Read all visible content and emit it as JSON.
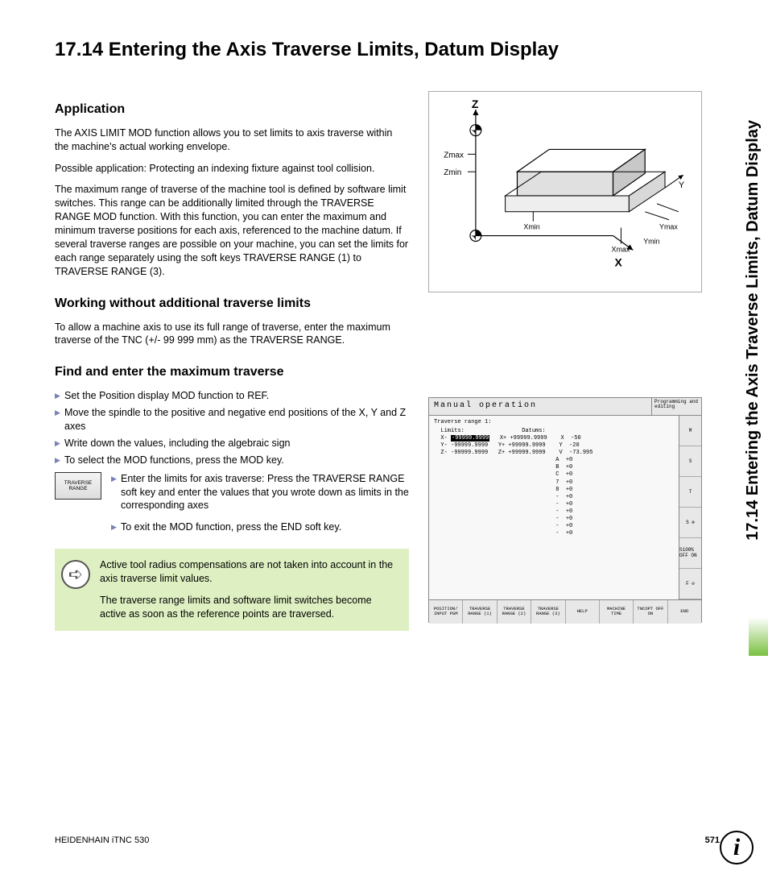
{
  "sideTab": "17.14 Entering the Axis Traverse Limits, Datum Display",
  "title": "17.14 Entering the Axis Traverse Limits, Datum Display",
  "h_application": "Application",
  "p_app_1": "The AXIS LIMIT MOD function allows you to set limits to axis traverse within the machine's actual working envelope.",
  "p_app_2": "Possible application: Protecting an indexing fixture against tool collision.",
  "p_app_3": "The maximum range of traverse of the machine tool is defined by software limit switches. This range can be additionally limited through the TRAVERSE RANGE MOD function. With this function, you can enter the maximum and minimum traverse positions for each axis, referenced to the machine datum. If several traverse ranges are possible on your machine, you can set the limits for each range separately using the soft keys TRAVERSE RANGE (1) to TRAVERSE RANGE (3).",
  "h_working": "Working without additional traverse limits",
  "p_working": "To allow a machine axis to use its full range of traverse, enter the maximum traverse of the TNC (+/- 99 999 mm) as the TRAVERSE RANGE.",
  "h_find": "Find and enter the maximum traverse",
  "bullets": [
    "Set the Position display MOD function to REF.",
    "Move the spindle to the positive and negative end positions of the X, Y and Z axes",
    "Write down the values, including the algebraic sign",
    "To select the MOD functions, press the MOD key."
  ],
  "softkey": {
    "l1": "TRAVERSE",
    "l2": "RANGE"
  },
  "softkey_steps": [
    "Enter the limits for axis traverse: Press the TRAVERSE RANGE soft key and enter the values that you wrote down as limits in the corresponding axes",
    "To exit the MOD function, press the END soft key."
  ],
  "note1": "Active tool radius compensations are not taken into account in the axis traverse limit values.",
  "note2": "The traverse range limits and software limit switches become active as soon as the reference points are traversed.",
  "diagram": {
    "Z": "Z",
    "X": "X",
    "Y": "Y",
    "Zmax": "Zmax",
    "Zmin": "Zmin",
    "Xmin": "Xmin",
    "Xmax": "Xmax",
    "Ymin": "Ymin",
    "Ymax": "Ymax"
  },
  "screen": {
    "title": "Manual operation",
    "mode": "Programming and editing",
    "hdr": "Traverse range 1:",
    "limits_label": "Limits:",
    "datums_label": "Datums:",
    "limits": [
      "X- -99999.9999   X+ +99999.9999",
      "Y- -99999.9999   Y+ +99999.9999",
      "Z- -99999.9999   Z+ +99999.9999"
    ],
    "datums": [
      "X  -50",
      "Y  -20",
      "V  -73.995",
      "A  +0",
      "B  +0",
      "C  +0",
      "7  +0",
      "8  +0",
      "-  +0",
      "-  +0",
      "-  +0",
      "-  +0",
      "-  +0",
      "-  +0"
    ],
    "side": [
      "M",
      "S",
      "T",
      "S ⊕",
      "S100% OFF ON",
      "F ⊖"
    ],
    "softkeys": [
      "POSITION/\nINPUT PGM",
      "TRAVERSE\nRANGE\n(1)",
      "TRAVERSE\nRANGE\n(2)",
      "TRAVERSE\nRANGE\n(3)",
      "HELP",
      "MACHINE\nTIME",
      "TNCOPT\nOFF  ON",
      "END"
    ]
  },
  "footer_left": "HEIDENHAIN iTNC 530",
  "footer_page": "571",
  "info_icon": "i"
}
